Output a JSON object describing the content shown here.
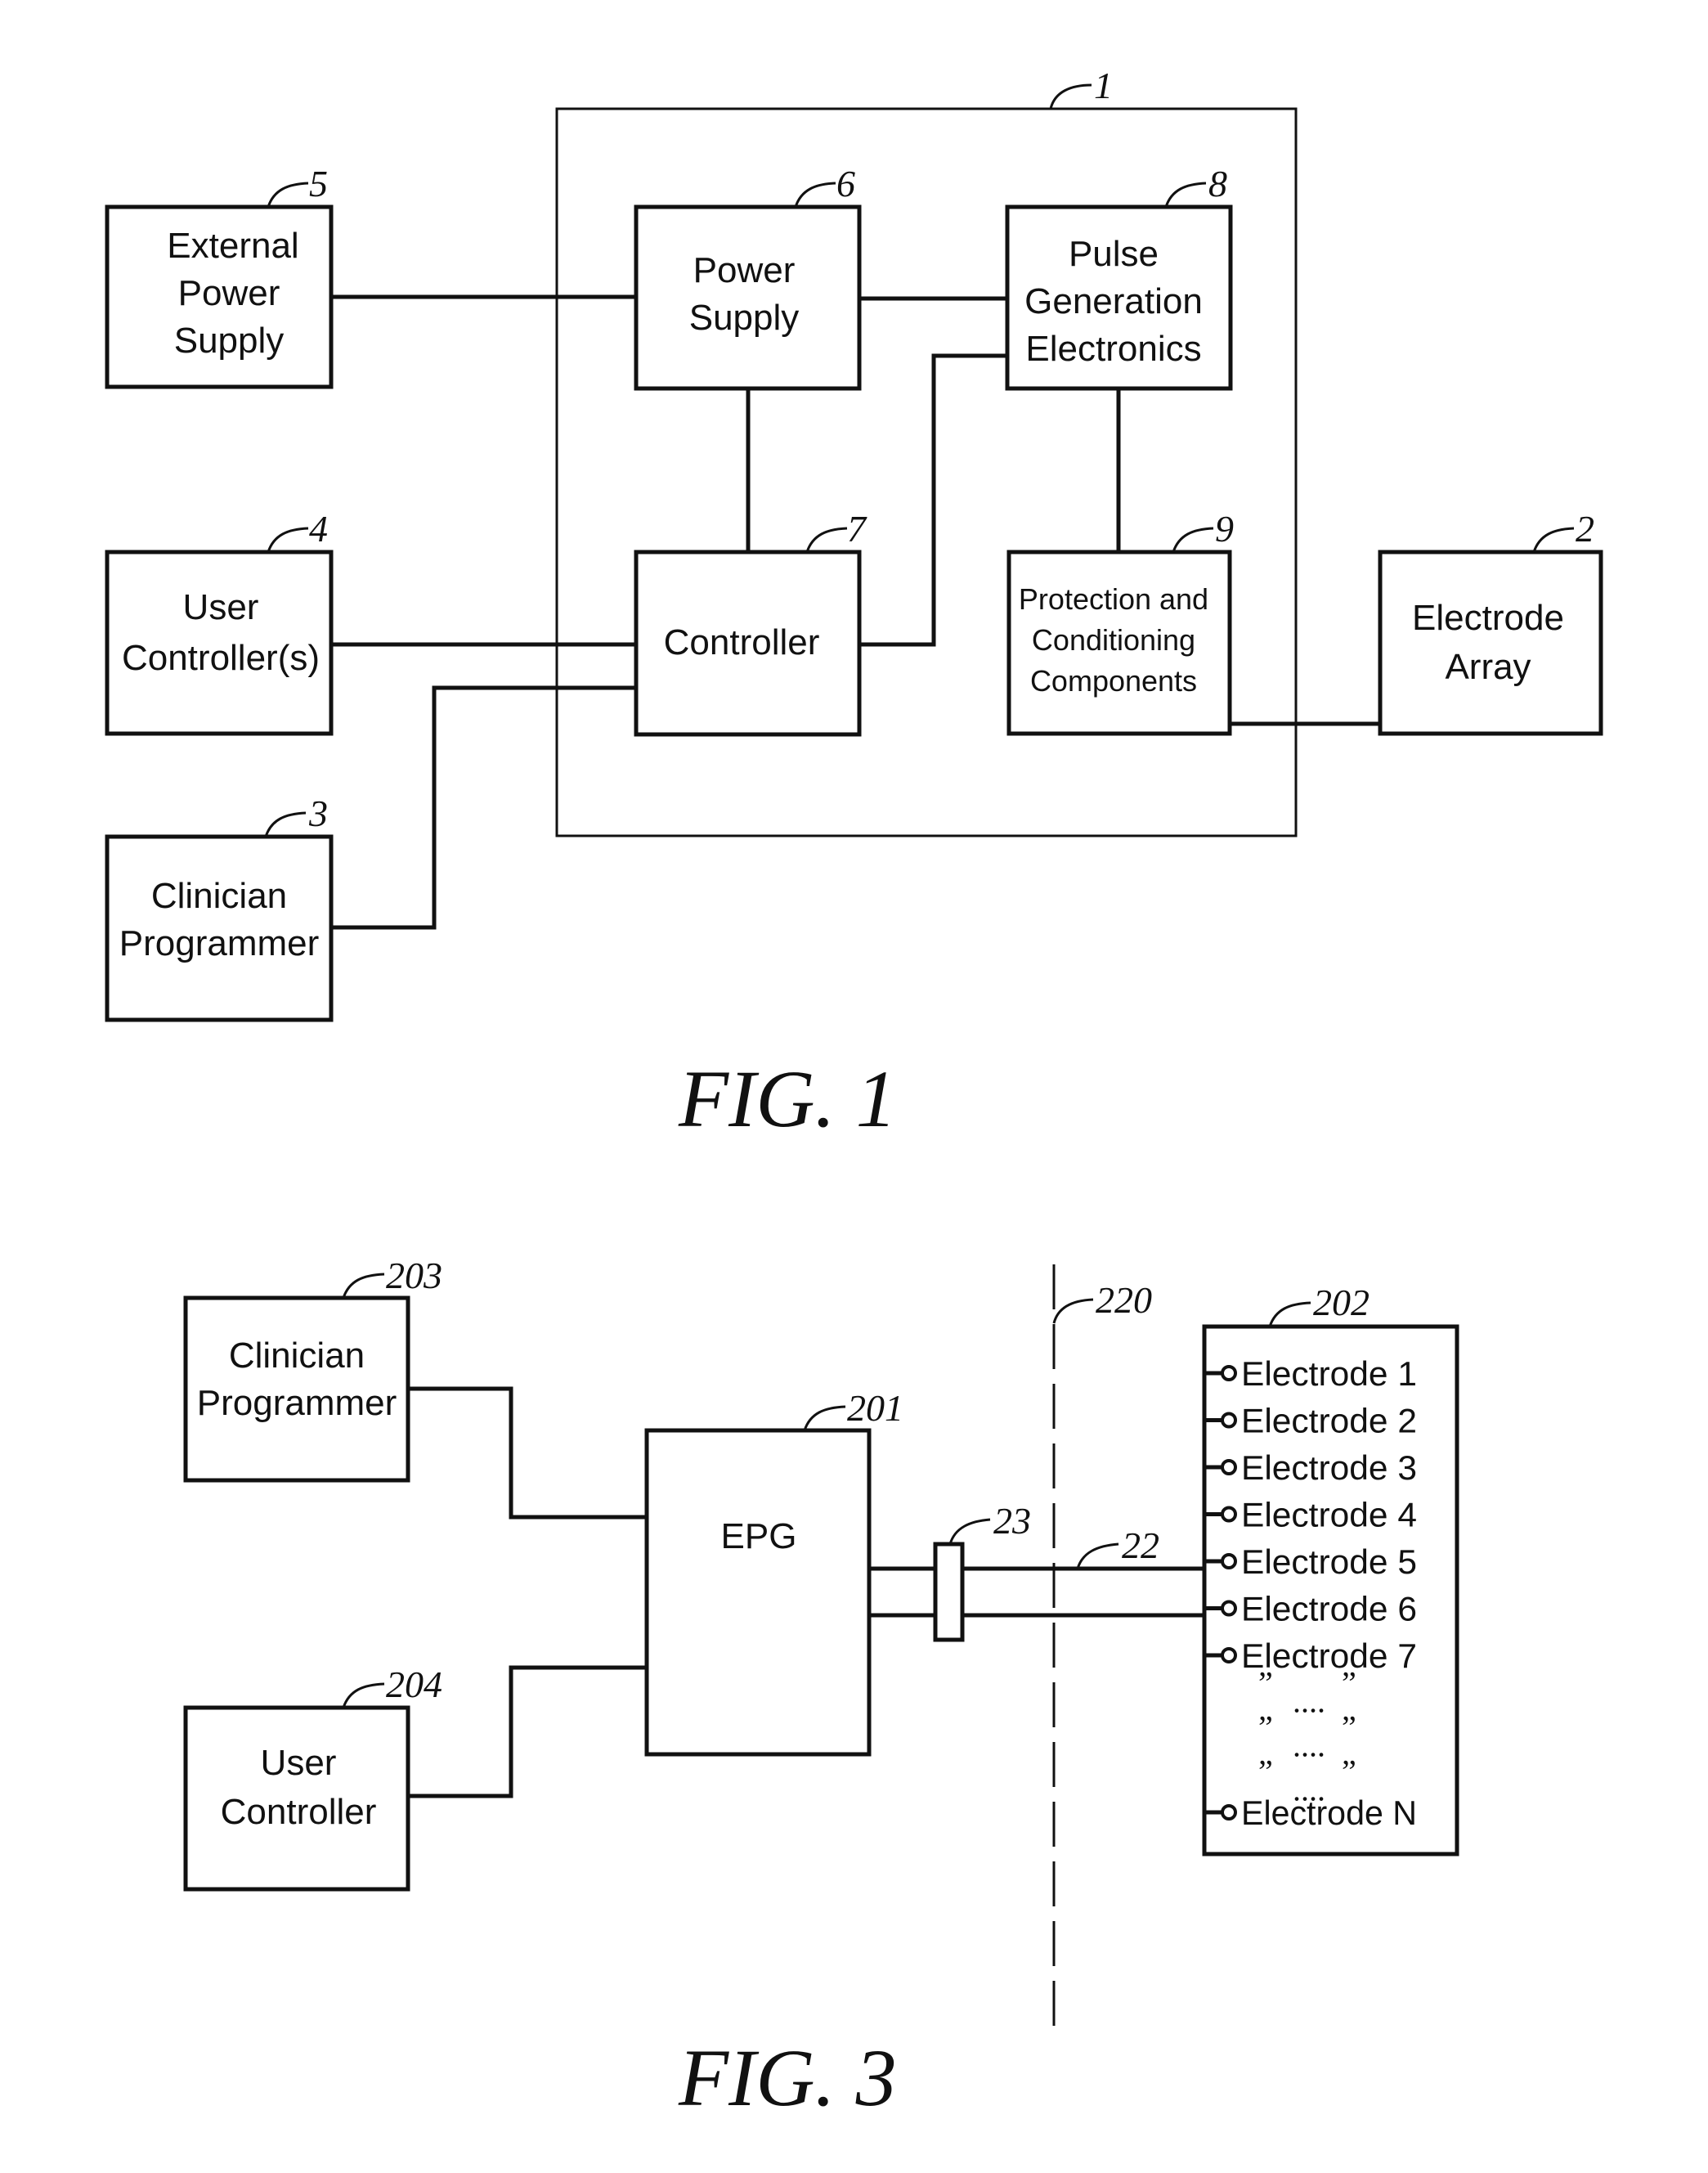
{
  "fig1": {
    "caption": "FIG. 1",
    "system_ref": "1",
    "blocks": {
      "external_power_supply": {
        "ref": "5",
        "lines": [
          "External",
          "Power",
          "Supply"
        ]
      },
      "power_supply": {
        "ref": "6",
        "lines": [
          "Power",
          "Supply"
        ]
      },
      "pulse_generation": {
        "ref": "8",
        "lines": [
          "Pulse",
          "Generation",
          "Electronics"
        ]
      },
      "user_controllers": {
        "ref": "4",
        "lines": [
          "User",
          "Controller(s)"
        ]
      },
      "controller": {
        "ref": "7",
        "lines": [
          "Controller"
        ]
      },
      "protection": {
        "ref": "9",
        "lines": [
          "Protection and",
          "Conditioning",
          "Components"
        ]
      },
      "electrode_array": {
        "ref": "2",
        "lines": [
          "Electrode",
          "Array"
        ]
      },
      "clinician_programmer": {
        "ref": "3",
        "lines": [
          "Clinician",
          "Programmer"
        ]
      }
    }
  },
  "fig3": {
    "caption": "FIG. 3",
    "blocks": {
      "clinician_programmer": {
        "ref": "203",
        "lines": [
          "Clinician",
          "Programmer"
        ]
      },
      "user_controller": {
        "ref": "204",
        "lines": [
          "User",
          "Controller"
        ]
      },
      "epg": {
        "ref": "201",
        "lines": [
          "EPG"
        ]
      },
      "electrodes": {
        "ref": "202",
        "items": [
          "Electrode 1",
          "Electrode 2",
          "Electrode 3",
          "Electrode 4",
          "Electrode 5",
          "Electrode 6",
          "Electrode 7"
        ],
        "ellipsis_rows": 3,
        "last": "Electrode N"
      }
    },
    "connector_ref": "23",
    "lead_ref": "22",
    "boundary_ref": "220"
  }
}
